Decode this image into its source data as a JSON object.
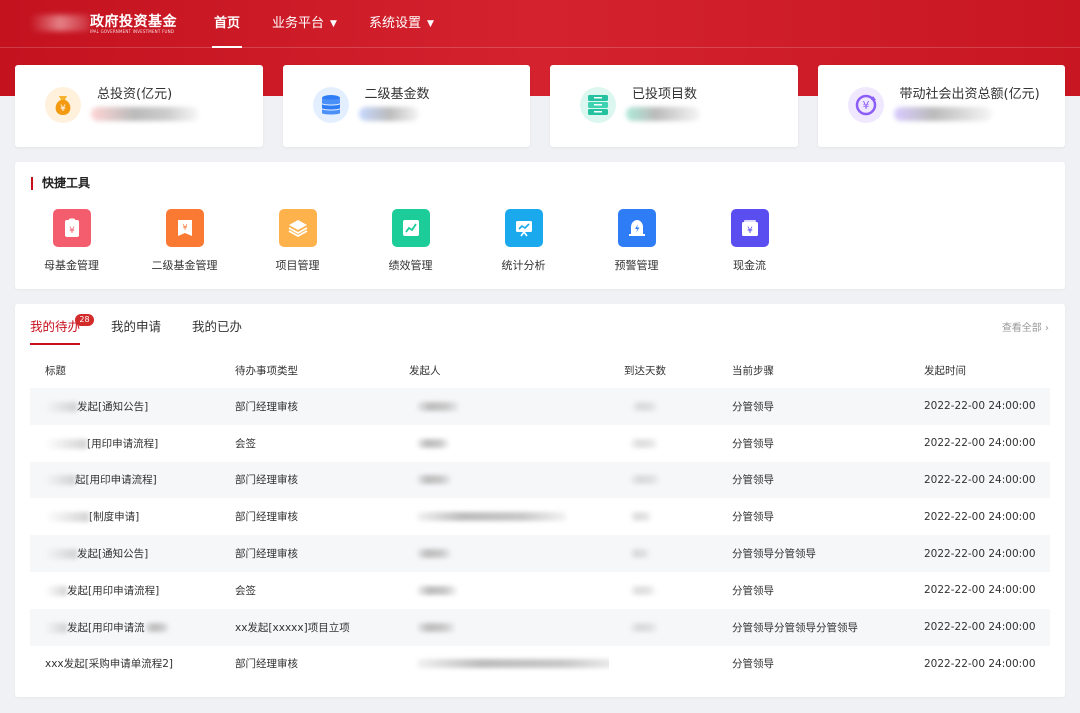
{
  "header": {
    "logo_title": "政府投资基金",
    "logo_subtitle": "IPAL GOVERNMENT INVESTMENT FUND",
    "nav": [
      {
        "label": "首页",
        "active": true,
        "dropdown": false
      },
      {
        "label": "业务平台",
        "active": false,
        "dropdown": true
      },
      {
        "label": "系统设置",
        "active": false,
        "dropdown": true
      }
    ]
  },
  "colors": {
    "brand": "#c8101d",
    "nav_bg": "#cf1e2a"
  },
  "stats": [
    {
      "label": "总投资(亿元)",
      "icon": "money-bag-icon",
      "color": "#f4a11a"
    },
    {
      "label": "二级基金数",
      "icon": "database-icon",
      "color": "#2e7cf6"
    },
    {
      "label": "已投项目数",
      "icon": "server-icon",
      "color": "#25c2a0"
    },
    {
      "label": "带动社会出资总额(亿元)",
      "icon": "yuan-cycle-icon",
      "color": "#8b5cf6"
    }
  ],
  "quick": {
    "title": "快捷工具",
    "tools": [
      {
        "label": "母基金管理",
        "icon": "clipboard-yuan-icon",
        "color": "#f45d6e"
      },
      {
        "label": "二级基金管理",
        "icon": "ledger-yuan-icon",
        "color": "#fa7a34"
      },
      {
        "label": "项目管理",
        "icon": "layers-icon",
        "color": "#fdb24c"
      },
      {
        "label": "绩效管理",
        "icon": "trend-chart-icon",
        "color": "#1ccd9a"
      },
      {
        "label": "统计分析",
        "icon": "presentation-chart-icon",
        "color": "#1aa9ec"
      },
      {
        "label": "预警管理",
        "icon": "alarm-icon",
        "color": "#2e7cf6"
      },
      {
        "label": "现金流",
        "icon": "wallet-yuan-icon",
        "color": "#5b4ef0"
      }
    ]
  },
  "todo": {
    "tabs": [
      {
        "label": "我的待办",
        "badge": "28",
        "active": true
      },
      {
        "label": "我的申请",
        "active": false
      },
      {
        "label": "我的已办",
        "active": false
      }
    ],
    "view_all": "查看全部 ›",
    "columns": [
      "标题",
      "待办事项类型",
      "发起人",
      "到达天数",
      "当前步骤",
      "发起时间"
    ],
    "rows": [
      {
        "title": "发起[通知公告]",
        "type": "部门经理审核",
        "step": "分管领导",
        "time": "2022-22-00 24:00:00"
      },
      {
        "title": "[用印申请流程]",
        "type": "会签",
        "step": "分管领导",
        "time": "2022-22-00 24:00:00"
      },
      {
        "title": "起[用印申请流程]",
        "type": "部门经理审核",
        "step": "分管领导",
        "time": "2022-22-00 24:00:00"
      },
      {
        "title": "[制度申请]",
        "type": "部门经理审核",
        "step": "分管领导",
        "time": "2022-22-00 24:00:00"
      },
      {
        "title": "发起[通知公告]",
        "type": "部门经理审核",
        "step": "分管领导分管领导",
        "time": "2022-22-00 24:00:00"
      },
      {
        "title": "发起[用印申请流程]",
        "type": "会签",
        "step": "分管领导",
        "time": "2022-22-00 24:00:00"
      },
      {
        "title": "发起[用印申请流",
        "type": "xx发起[xxxxx]项目立项",
        "step": "分管领导分管领导分管领导",
        "time": "2022-22-00 24:00:00"
      },
      {
        "title": "xxx发起[采购申请单流程2]",
        "type": "部门经理审核",
        "step": "分管领导",
        "time": "2022-22-00 24:00:00"
      }
    ]
  }
}
